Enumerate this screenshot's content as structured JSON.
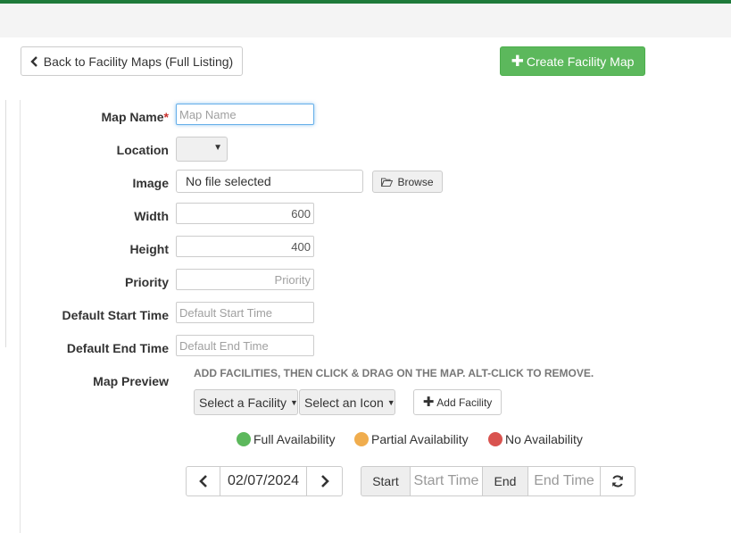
{
  "header": {
    "back_label": "Back to Facility Maps (Full Listing)",
    "create_label": "Create Facility Map"
  },
  "form": {
    "map_name": {
      "label": "Map Name",
      "required_mark": "*",
      "value": "",
      "placeholder": "Map Name"
    },
    "location": {
      "label": "Location",
      "value": ""
    },
    "image": {
      "label": "Image",
      "file_text": "No file selected",
      "browse_label": "Browse"
    },
    "width": {
      "label": "Width",
      "value": "600"
    },
    "height": {
      "label": "Height",
      "value": "400"
    },
    "priority": {
      "label": "Priority",
      "value": "",
      "placeholder": "Priority"
    },
    "default_start_time": {
      "label": "Default Start Time",
      "value": "",
      "placeholder": "Default Start Time"
    },
    "default_end_time": {
      "label": "Default End Time",
      "value": "",
      "placeholder": "Default End Time"
    }
  },
  "preview": {
    "label": "Map Preview",
    "hint": "ADD FACILITIES, THEN CLICK & DRAG ON THE MAP. ALT-CLICK TO REMOVE.",
    "facility_select": "Select a Facility",
    "icon_select": "Select an Icon",
    "add_facility_label": "Add Facility",
    "legend": [
      {
        "label": "Full Availability",
        "color": "#5cb85c"
      },
      {
        "label": "Partial Availability",
        "color": "#f0ad4e"
      },
      {
        "label": "No Availability",
        "color": "#d9534f"
      }
    ],
    "date": "02/07/2024",
    "start_label": "Start",
    "start_time_placeholder": "Start Time",
    "end_label": "End",
    "end_time_placeholder": "End Time"
  },
  "icons": {
    "back": "chevron-left-icon",
    "create": "plus-icon",
    "browse": "folder-open-icon",
    "prev": "chevron-left-icon",
    "next": "chevron-right-icon",
    "refresh": "refresh-icon"
  }
}
